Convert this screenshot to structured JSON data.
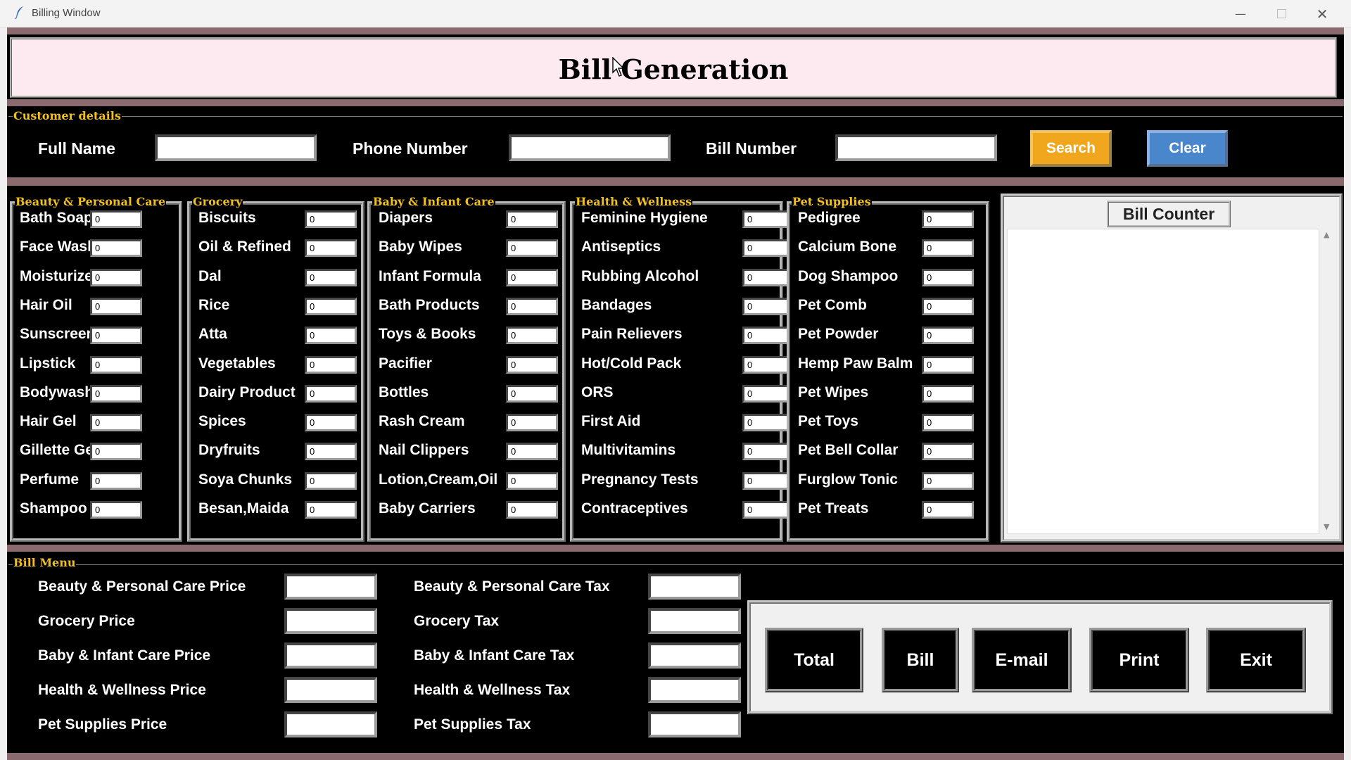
{
  "window": {
    "title": "Billing Window"
  },
  "header": {
    "title": "Bill Generation"
  },
  "customer": {
    "legend": "Customer details",
    "full_name_label": "Full Name",
    "phone_label": "Phone Number",
    "bill_number_label": "Bill Number",
    "full_name_value": "",
    "phone_value": "",
    "bill_number_value": "",
    "search_label": "Search",
    "clear_label": "Clear"
  },
  "categories": [
    {
      "legend": "Beauty & Personal Care",
      "items": [
        {
          "name": "Bath Soap",
          "qty": "0"
        },
        {
          "name": "Face Wash",
          "qty": "0"
        },
        {
          "name": "Moisturizer",
          "qty": "0"
        },
        {
          "name": "Hair Oil",
          "qty": "0"
        },
        {
          "name": "Sunscreen",
          "qty": "0"
        },
        {
          "name": "Lipstick",
          "qty": "0"
        },
        {
          "name": "Bodywash",
          "qty": "0"
        },
        {
          "name": "Hair Gel",
          "qty": "0"
        },
        {
          "name": "Gillette Gel",
          "qty": "0"
        },
        {
          "name": "Perfume",
          "qty": "0"
        },
        {
          "name": "Shampoo",
          "qty": "0"
        }
      ]
    },
    {
      "legend": "Grocery",
      "items": [
        {
          "name": "Biscuits",
          "qty": "0"
        },
        {
          "name": "Oil & Refined",
          "qty": "0"
        },
        {
          "name": "Dal",
          "qty": "0"
        },
        {
          "name": "Rice",
          "qty": "0"
        },
        {
          "name": "Atta",
          "qty": "0"
        },
        {
          "name": "Vegetables",
          "qty": "0"
        },
        {
          "name": "Dairy Product",
          "qty": "0"
        },
        {
          "name": "Spices",
          "qty": "0"
        },
        {
          "name": "Dryfruits",
          "qty": "0"
        },
        {
          "name": "Soya Chunks",
          "qty": "0"
        },
        {
          "name": "Besan,Maida",
          "qty": "0"
        }
      ]
    },
    {
      "legend": "Baby & Infant Care",
      "items": [
        {
          "name": "Diapers",
          "qty": "0"
        },
        {
          "name": "Baby Wipes",
          "qty": "0"
        },
        {
          "name": "Infant Formula",
          "qty": "0"
        },
        {
          "name": "Bath Products",
          "qty": "0"
        },
        {
          "name": "Toys & Books",
          "qty": "0"
        },
        {
          "name": "Pacifier",
          "qty": "0"
        },
        {
          "name": "Bottles",
          "qty": "0"
        },
        {
          "name": "Rash Cream",
          "qty": "0"
        },
        {
          "name": "Nail Clippers",
          "qty": "0"
        },
        {
          "name": "Lotion,Cream,Oil",
          "qty": "0"
        },
        {
          "name": "Baby Carriers",
          "qty": "0"
        }
      ]
    },
    {
      "legend": "Health & Wellness",
      "items": [
        {
          "name": "Feminine Hygiene",
          "qty": "0"
        },
        {
          "name": "Antiseptics",
          "qty": "0"
        },
        {
          "name": "Rubbing Alcohol",
          "qty": "0"
        },
        {
          "name": "Bandages",
          "qty": "0"
        },
        {
          "name": "Pain Relievers",
          "qty": "0"
        },
        {
          "name": "Hot/Cold Pack",
          "qty": "0"
        },
        {
          "name": "ORS",
          "qty": "0"
        },
        {
          "name": "First Aid",
          "qty": "0"
        },
        {
          "name": "Multivitamins",
          "qty": "0"
        },
        {
          "name": "Pregnancy Tests",
          "qty": "0"
        },
        {
          "name": "Contraceptives",
          "qty": "0"
        }
      ]
    },
    {
      "legend": "Pet Supplies",
      "items": [
        {
          "name": "Pedigree",
          "qty": "0"
        },
        {
          "name": "Calcium Bone",
          "qty": "0"
        },
        {
          "name": "Dog Shampoo",
          "qty": "0"
        },
        {
          "name": "Pet Comb",
          "qty": "0"
        },
        {
          "name": "Pet Powder",
          "qty": "0"
        },
        {
          "name": "Hemp Paw Balm",
          "qty": "0"
        },
        {
          "name": "Pet Wipes",
          "qty": "0"
        },
        {
          "name": "Pet Toys",
          "qty": "0"
        },
        {
          "name": "Pet Bell Collar",
          "qty": "0"
        },
        {
          "name": "Furglow Tonic",
          "qty": "0"
        },
        {
          "name": "Pet Treats",
          "qty": "0"
        }
      ]
    }
  ],
  "bill_counter": {
    "title": "Bill Counter",
    "text": ""
  },
  "bill_menu": {
    "legend": "Bill Menu",
    "prices": [
      {
        "label": "Beauty & Personal Care Price",
        "value": ""
      },
      {
        "label": "Grocery Price",
        "value": ""
      },
      {
        "label": "Baby & Infant Care Price",
        "value": ""
      },
      {
        "label": "Health & Wellness Price",
        "value": ""
      },
      {
        "label": "Pet Supplies Price",
        "value": ""
      }
    ],
    "taxes": [
      {
        "label": "Beauty & Personal Care Tax",
        "value": ""
      },
      {
        "label": "Grocery Tax",
        "value": ""
      },
      {
        "label": "Baby & Infant Care Tax",
        "value": ""
      },
      {
        "label": "Health & Wellness Tax",
        "value": ""
      },
      {
        "label": "Pet Supplies Tax",
        "value": ""
      }
    ],
    "buttons": [
      "Total",
      "Bill",
      "E-mail",
      "Print",
      "Exit"
    ]
  },
  "colors": {
    "band": "#8a6a6e",
    "header_bg": "#fde9f0",
    "legend": "#f0c020",
    "search_button": "#f0a71e",
    "clear_button": "#4a86cc"
  },
  "icons": {
    "app": "feather-icon",
    "minimize": "minimize-icon",
    "maximize": "maximize-icon",
    "close": "close-icon",
    "cursor": "mouse-cursor-icon"
  }
}
